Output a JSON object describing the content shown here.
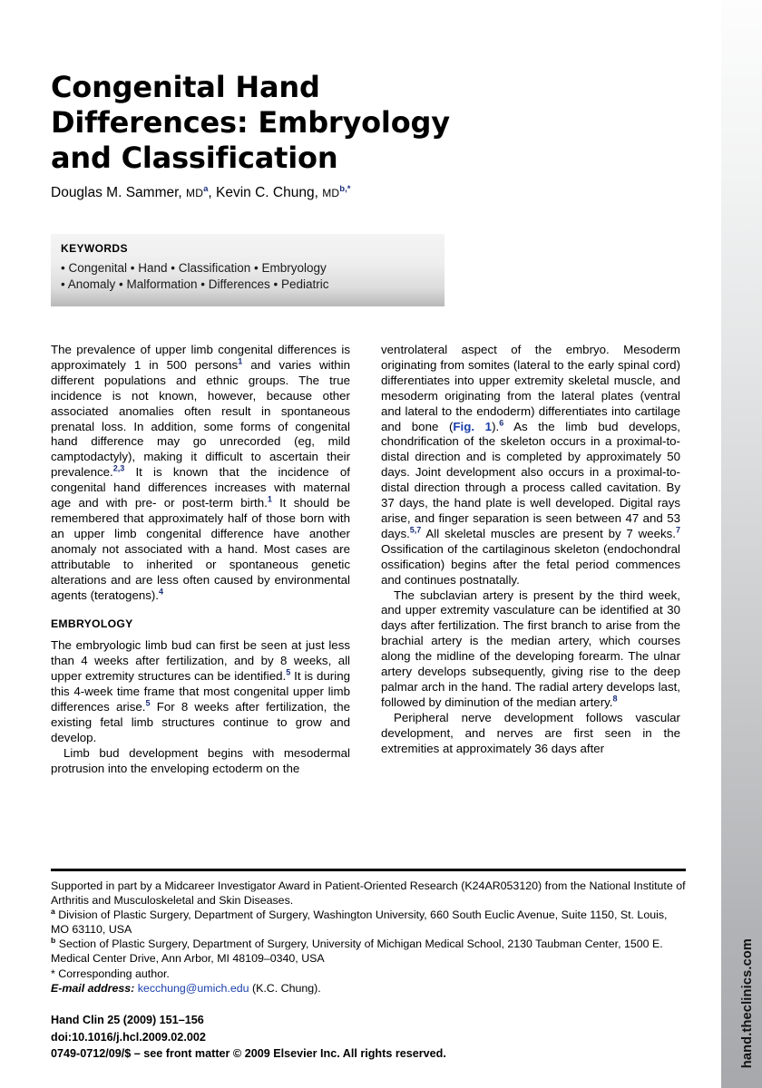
{
  "article": {
    "title_lines": [
      "Congenital Hand",
      "Differences: Embryology",
      "and Classification"
    ],
    "authors": {
      "author1_name": "Douglas M. Sammer,",
      "author1_degree": "MD",
      "author1_sup": "a",
      "separator": ", ",
      "author2_name": "Kevin C. Chung,",
      "author2_degree": "MD",
      "author2_sup": "b,*"
    }
  },
  "keywords": {
    "label": "KEYWORDS",
    "line1": "• Congenital • Hand • Classification • Embryology",
    "line2": "• Anomaly • Malformation • Differences • Pediatric",
    "terms": [
      "Congenital",
      "Hand",
      "Classification",
      "Embryology",
      "Anomaly",
      "Malformation",
      "Differences",
      "Pediatric"
    ]
  },
  "body": {
    "left_column": {
      "para1_a": "The prevalence of upper limb congenital differences is approximately 1 in 500 persons",
      "para1_sup1": "1",
      "para1_b": " and varies within different populations and ethnic groups. The true incidence is not known, however, because other associated anomalies often result in spontaneous prenatal loss. In addition, some forms of congenital hand difference may go unrecorded (eg, mild camptodactyly), making it difficult to ascertain their prevalence.",
      "para1_sup2": "2,3",
      "para1_c": " It is known that the incidence of congenital hand differences increases with maternal age and with pre- or post-term birth.",
      "para1_sup3": "1",
      "para1_d": " It should be remembered that approximately half of those born with an upper limb congenital difference have another anomaly not associated with a hand. Most cases are attributable to inherited or spontaneous genetic alterations and are less often caused by environmental agents (teratogens).",
      "para1_sup4": "4",
      "section_heading": "EMBRYOLOGY",
      "para2_a": "The embryologic limb bud can first be seen at just less than 4 weeks after fertilization, and by 8 weeks, all upper extremity structures can be identified.",
      "para2_sup1": "5",
      "para2_b": " It is during this 4-week time frame that most congenital upper limb differences arise.",
      "para2_sup2": "5",
      "para2_c": " For 8 weeks after fertilization, the existing fetal limb structures continue to grow and develop.",
      "para3": "Limb bud development begins with mesodermal protrusion into the enveloping ectoderm on the"
    },
    "right_column": {
      "para1_a": "ventrolateral aspect of the embryo. Mesoderm originating from somites (lateral to the early spinal cord) differentiates into upper extremity skeletal muscle, and mesoderm originating from the lateral plates (ventral and lateral to the endoderm) differentiates into cartilage and bone (",
      "para1_figref": "Fig. 1",
      "para1_b": ").",
      "para1_sup1": "6",
      "para1_c": " As the limb bud develops, chondrification of the skeleton occurs in a proximal-to-distal direction and is completed by approximately 50 days. Joint development also occurs in a proximal-to-distal direction through a process called cavitation. By 37 days, the hand plate is well developed. Digital rays arise, and finger separation is seen between 47 and 53 days.",
      "para1_sup2": "5,7",
      "para1_d": " All skeletal muscles are present by 7 weeks.",
      "para1_sup3": "7",
      "para1_e": " Ossification of the cartilaginous skeleton (endochondral ossification) begins after the fetal period commences and continues postnatally.",
      "para2_a": "The subclavian artery is present by the third week, and upper extremity vasculature can be identified at 30 days after fertilization. The first branch to arise from the brachial artery is the median artery, which courses along the midline of the developing forearm. The ulnar artery develops subsequently, giving rise to the deep palmar arch in the hand. The radial artery develops last, followed by diminution of the median artery.",
      "para2_sup1": "8",
      "para3": "Peripheral nerve development follows vascular development, and nerves are first seen in the extremities at approximately 36 days after"
    }
  },
  "footnotes": {
    "funding": "Supported in part by a Midcareer Investigator Award in Patient-Oriented Research (K24AR053120) from the National Institute of Arthritis and Musculoskeletal and Skin Diseases.",
    "affil_a_sup": "a",
    "affil_a": " Division of Plastic Surgery, Department of Surgery, Washington University, 660 South Euclic Avenue, Suite 1150, St. Louis, MO 63110, USA",
    "affil_b_sup": "b",
    "affil_b": " Section of Plastic Surgery, Department of Surgery, University of Michigan Medical School, 2130 Taubman Center, 1500 E. Medical Center Drive, Ann Arbor, MI 48109–0340, USA",
    "corresponding": "* Corresponding author.",
    "email_label": "E-mail address:",
    "email_link": "kecchung@umich.edu",
    "email_suffix": " (K.C. Chung)."
  },
  "citation": {
    "journal_line": "Hand Clin 25 (2009) 151–156",
    "doi_line": "doi:10.1016/j.hcl.2009.02.002",
    "copyright_line": "0749-0712/09/$ – see front matter © 2009 Elsevier Inc. All rights reserved."
  },
  "rail": {
    "url": "hand.theclinics.com"
  },
  "colors": {
    "link": "#1a3faa",
    "superscript": "#1a2f7a",
    "rule": "#000000",
    "rail_top": "#fdfdfd",
    "rail_bottom": "#a6a8ab",
    "keywords_top": "#f4f4f4",
    "keywords_bottom": "#b8b8b8"
  }
}
